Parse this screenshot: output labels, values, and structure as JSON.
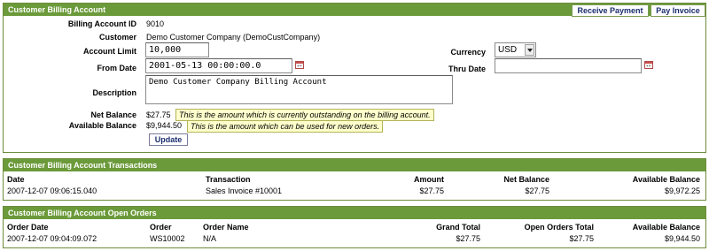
{
  "billing": {
    "title": "Customer Billing Account",
    "receive_payment": "Receive Payment",
    "pay_invoice": "Pay Invoice",
    "labels": {
      "billing_account_id": "Billing Account ID",
      "customer": "Customer",
      "account_limit": "Account Limit",
      "from_date": "From Date",
      "description": "Description",
      "net_balance": "Net Balance",
      "available_balance": "Available Balance",
      "currency": "Currency",
      "thru_date": "Thru Date"
    },
    "values": {
      "billing_account_id": "9010",
      "customer": "Demo Customer Company (DemoCustCompany)",
      "account_limit": "10,000",
      "from_date": "2001-05-13 00:00:00.0",
      "description": "Demo Customer Company Billing Account",
      "net_balance": "$27.75",
      "available_balance": "$9,944.50",
      "currency": "USD",
      "thru_date": ""
    },
    "hints": {
      "net_balance": "This is the amount which is currently outstanding on the billing account.",
      "available_balance": "This is the amount which can be used for new orders."
    },
    "update_button": "Update"
  },
  "transactions": {
    "title": "Customer Billing Account Transactions",
    "columns": [
      "Date",
      "Transaction",
      "Amount",
      "Net Balance",
      "Available Balance"
    ],
    "rows": [
      [
        "2007-12-07 09:06:15.040",
        "Sales Invoice #10001",
        "$27.75",
        "$27.75",
        "$9,972.25"
      ]
    ]
  },
  "open_orders": {
    "title": "Customer Billing Account Open Orders",
    "columns": [
      "Order Date",
      "Order",
      "Order Name",
      "Grand Total",
      "Open Orders Total",
      "Available Balance"
    ],
    "rows": [
      [
        "2007-12-07 09:04:09.072",
        "WS10002",
        "N/A",
        "$27.75",
        "$27.75",
        "$9,944.50"
      ]
    ]
  },
  "colors": {
    "header_bg": "#6b9a3a",
    "link_text": "#1a2d6e",
    "hint_bg": "#ffffcc"
  }
}
